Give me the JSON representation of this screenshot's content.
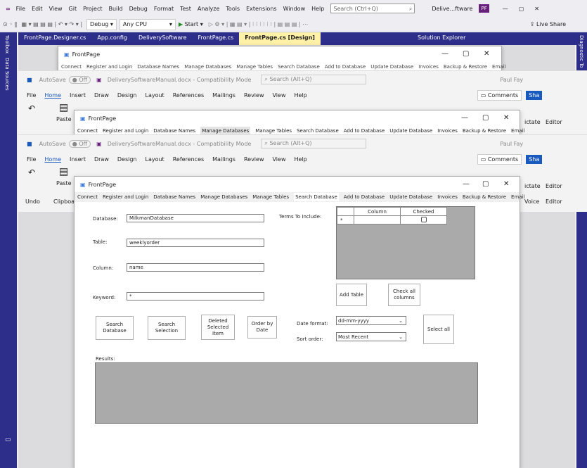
{
  "vs": {
    "menu": [
      "File",
      "Edit",
      "View",
      "Git",
      "Project",
      "Build",
      "Debug",
      "Format",
      "Test",
      "Analyze",
      "Tools",
      "Extensions",
      "Window",
      "Help"
    ],
    "search_placeholder": "Search (Ctrl+Q)",
    "solution_name": "Delive...ftware",
    "profile": "PF",
    "config": "Debug",
    "platform": "Any CPU",
    "start_label": "Start",
    "live_share": "Live Share",
    "tabs": [
      "FrontPage.Designer.cs",
      "App.config",
      "DeliverySoftware",
      "FrontPage.cs",
      "FrontPage.cs [Design]"
    ],
    "solution_explorer": "Solution Explorer",
    "left_strip": [
      "Toolbox",
      "Data Sources"
    ],
    "right_strip": "Diagnostic To"
  },
  "back_form": {
    "title": "FrontPage",
    "menu": [
      "Connect",
      "Register and Login",
      "Database Names",
      "Manage Databases",
      "Manage Tables",
      "Search Database",
      "Add to Database",
      "Update Database",
      "Invoices",
      "Backup & Restore",
      "Email"
    ]
  },
  "word": {
    "autosave": "AutoSave",
    "toggle": "Off",
    "doc_title": "DeliverySoftwareManual.docx - Compatibility Mode",
    "search": "Search (Alt+Q)",
    "user": "Paul Fay",
    "tabs": [
      "File",
      "Home",
      "Insert",
      "Draw",
      "Design",
      "Layout",
      "References",
      "Mailings",
      "Review",
      "View",
      "Help"
    ],
    "comments": "Comments",
    "share": "Sha",
    "paste": "Paste",
    "undo": "Undo",
    "clipboard": "Clipboar",
    "dictate": "ictate",
    "editor": "Editor",
    "voice": "Voice"
  },
  "middle_form": {
    "title": "FrontPage",
    "menu": [
      "Connect",
      "Register and Login",
      "Database Names",
      "Manage Databases",
      "Manage Tables",
      "Search Database",
      "Add to Database",
      "Update Database",
      "Invoices",
      "Backup & Restore",
      "Email"
    ]
  },
  "front_form": {
    "title": "FrontPage",
    "menu": [
      "Connect",
      "Register and Login",
      "Database Names",
      "Manage Databases",
      "Manage Tables",
      "Search Database",
      "Add to Database",
      "Update Database",
      "Invoices",
      "Backup & Restore",
      "Email"
    ],
    "database_label": "Database:",
    "database_value": "MilkmanDatabase",
    "table_label": "Table:",
    "table_value": "weeklyorder",
    "column_label": "Column:",
    "column_value": "name",
    "keyword_label": "Keyword:",
    "keyword_value": "*",
    "terms_label": "Terms To Include:",
    "grid_headers": [
      "Column",
      "Checked"
    ],
    "grid_marker": "*",
    "add_table": "Add Table",
    "check_all": "Check all columns",
    "search_database": "Search Database",
    "search_selection": "Search Selection",
    "deleted_selected": "Deleted Selected Item",
    "order_by_date": "Order by Date",
    "date_format_label": "Date format:",
    "date_format_value": "dd-mm-yyyy",
    "sort_order_label": "Sort order:",
    "sort_order_value": "Most Recent",
    "select_all": "Select all",
    "results_label": "Results:"
  }
}
